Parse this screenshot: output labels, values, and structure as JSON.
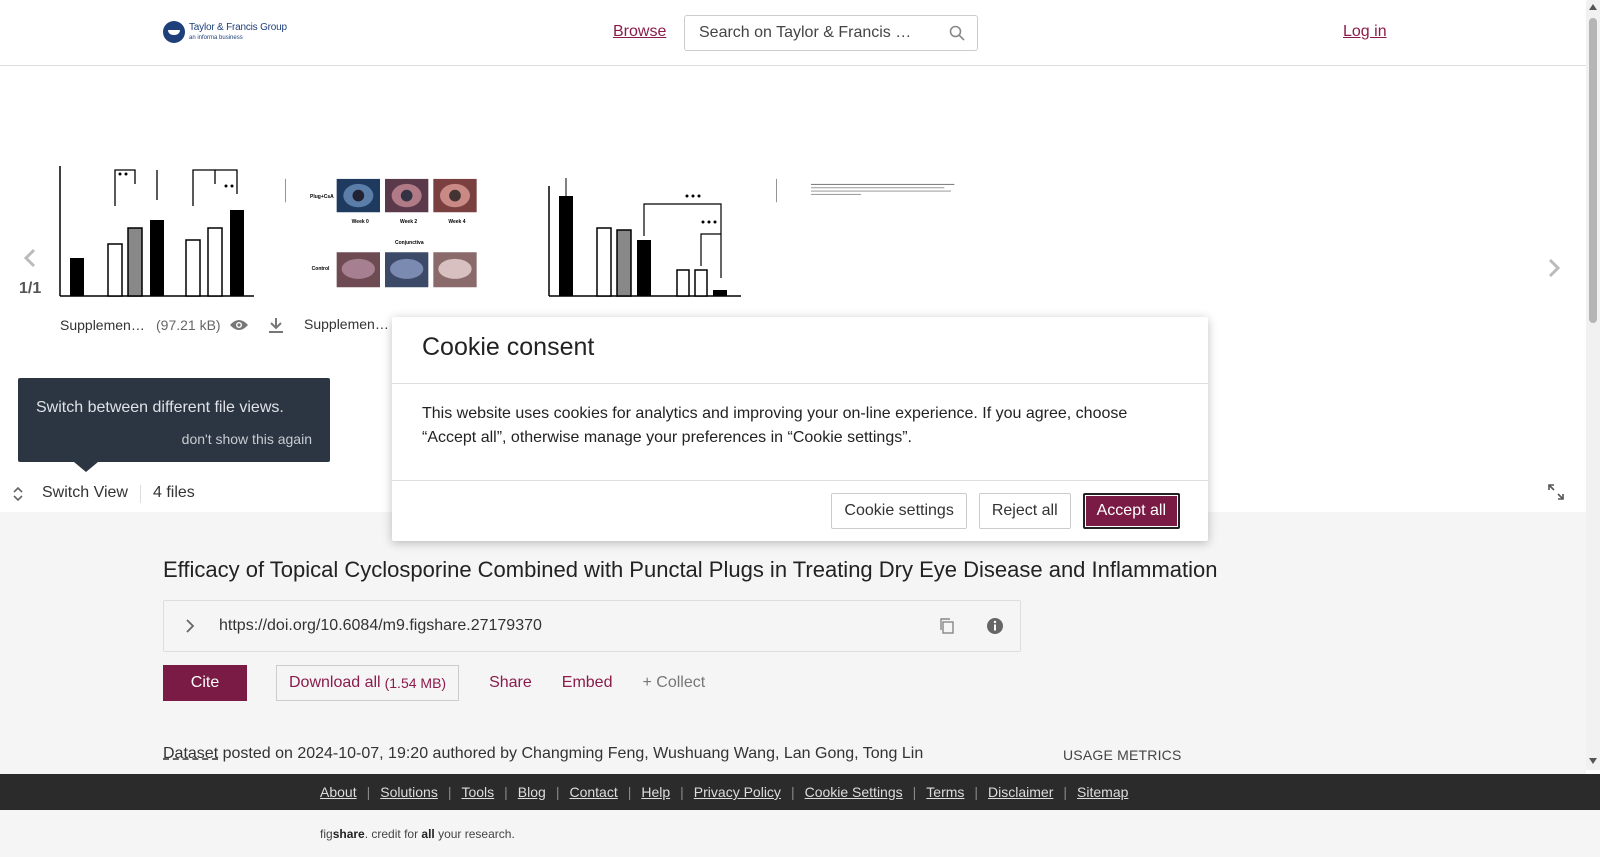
{
  "header": {
    "logo_title": "Taylor & Francis Group",
    "logo_sub": "an informa business",
    "browse": "Browse",
    "search_placeholder": "Search on Taylor & Francis …",
    "login": "Log in"
  },
  "viewer": {
    "counter": "1/1",
    "files": [
      {
        "name": "Supplementary",
        "size": "(97.21 kB)"
      },
      {
        "name": "Supplementary",
        "size": ""
      }
    ],
    "thumb_texts": {
      "plug_csa": "Plug+CsA",
      "control": "Control",
      "week0": "Week 0",
      "week2": "Week 2",
      "week4": "Week 4",
      "conjunctiva": "Conjunctiva"
    }
  },
  "tooltip": {
    "text": "Switch between different file views.",
    "dismiss": "don't show this again"
  },
  "switchbar": {
    "label": "Switch View",
    "files_count": "4 files"
  },
  "dataset": {
    "title": "Efficacy of Topical Cyclosporine Combined with Punctal Plugs in Treating Dry Eye Disease and Inflammation",
    "doi": "https://doi.org/10.6084/m9.figshare.27179370",
    "cite": "Cite",
    "download_all": "Download all",
    "download_size": "(1.54 MB)",
    "share": "Share",
    "embed": "Embed",
    "collect": "+ Collect",
    "type": "Dataset",
    "posted": "posted on 2024-10-07, 19:20 authored by Changming Feng, Wushuang Wang, Lan Gong, Tong Lin",
    "usage_metrics": "USAGE METRICS"
  },
  "footer": {
    "links": [
      "About",
      "Solutions",
      "Tools",
      "Blog",
      "Contact",
      "Help",
      "Privacy Policy",
      "Cookie Settings",
      "Terms",
      "Disclaimer",
      "Sitemap"
    ],
    "tagline_pre": "fig",
    "tagline_share": "share",
    "tagline_mid": ". credit for ",
    "tagline_all": "all",
    "tagline_post": " your research."
  },
  "cookie": {
    "title": "Cookie consent",
    "body": "This website uses cookies for analytics and improving your on-line experience. If you agree, choose “Accept all”, otherwise manage your preferences in “Cookie settings”.",
    "settings": "Cookie settings",
    "reject": "Reject all",
    "accept": "Accept all"
  },
  "colors": {
    "brand": "#7a1b45",
    "link": "#8b1c4a",
    "footer_bg": "#2b2b2b",
    "tooltip_bg": "#2c3542"
  }
}
